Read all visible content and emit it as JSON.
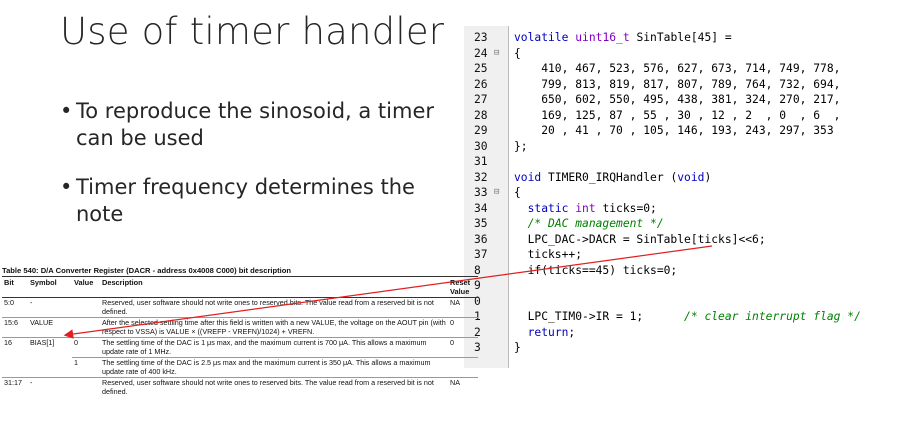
{
  "slide": {
    "title": "Use of timer handler",
    "bullets": [
      "To reproduce the sinosoid, a timer can be used",
      "Timer frequency determines the note"
    ]
  },
  "code": {
    "lines": [
      {
        "num": "23",
        "fold": "",
        "text": "volatile uint16_t SinTable[45] ="
      },
      {
        "num": "24",
        "fold": "⊟",
        "text": "{"
      },
      {
        "num": "25",
        "fold": "",
        "text": "    410, 467, 523, 576, 627, 673, 714, 749, 778,"
      },
      {
        "num": "26",
        "fold": "",
        "text": "    799, 813, 819, 817, 807, 789, 764, 732, 694,"
      },
      {
        "num": "27",
        "fold": "",
        "text": "    650, 602, 550, 495, 438, 381, 324, 270, 217,"
      },
      {
        "num": "28",
        "fold": "",
        "text": "    169, 125, 87 , 55 , 30 , 12 , 2  , 0  , 6  ,"
      },
      {
        "num": "29",
        "fold": "",
        "text": "    20 , 41 , 70 , 105, 146, 193, 243, 297, 353"
      },
      {
        "num": "30",
        "fold": "",
        "text": "};"
      },
      {
        "num": "31",
        "fold": "",
        "text": ""
      },
      {
        "num": "32",
        "fold": "",
        "text": "void TIMER0_IRQHandler (void)"
      },
      {
        "num": "33",
        "fold": "⊟",
        "text": "{"
      },
      {
        "num": "34",
        "fold": "",
        "text": "  static int ticks=0;"
      },
      {
        "num": "35",
        "fold": "",
        "text": "  /* DAC management */"
      },
      {
        "num": "36",
        "fold": "",
        "text": "  LPC_DAC->DACR = SinTable[ticks]<<6;"
      },
      {
        "num": "37",
        "fold": "",
        "text": "  ticks++;"
      },
      {
        "num": "8",
        "fold": "",
        "text": "  if(ticks==45) ticks=0;"
      },
      {
        "num": "9",
        "fold": "",
        "text": ""
      },
      {
        "num": "0",
        "fold": "",
        "text": ""
      },
      {
        "num": "1",
        "fold": "",
        "text": "  LPC_TIM0->IR = 1;      /* clear interrupt flag */"
      },
      {
        "num": "2",
        "fold": "",
        "text": "  return;"
      },
      {
        "num": "3",
        "fold": "",
        "text": "}"
      }
    ]
  },
  "register_table": {
    "caption": "Table 540: D/A Converter Register (DACR - address 0x4008 C000) bit description",
    "headers": [
      "Bit",
      "Symbol",
      "Value",
      "Description",
      "Reset Value"
    ],
    "rows": [
      [
        "5:0",
        "-",
        "",
        "Reserved, user software should not write ones to reserved bits. The value read from a reserved bit is not defined.",
        "NA"
      ],
      [
        "15:6",
        "VALUE",
        "",
        "After the selected settling time after this field is written with a new VALUE, the voltage on the AOUT pin (with respect to VSSA) is VALUE × ((VREFP - VREFN)/1024) + VREFN.",
        "0"
      ],
      [
        "16",
        "BIAS[1]",
        "0",
        "The settling time of the DAC is 1 μs max, and the maximum current is 700 μA. This allows a maximum update rate of 1 MHz.",
        "0"
      ],
      [
        "",
        "",
        "1",
        "The settling time of the DAC is 2.5 μs max and the maximum current is 350 μA. This allows a maximum update rate of 400 kHz.",
        ""
      ],
      [
        "31:17",
        "-",
        "",
        "Reserved, user software should not write ones to reserved bits. The value read from a reserved bit is not defined.",
        "NA"
      ]
    ]
  },
  "colors": {
    "arrow": "#e02020",
    "keyword": "#0000c0",
    "comment": "#008000",
    "number": "#0000ff"
  }
}
